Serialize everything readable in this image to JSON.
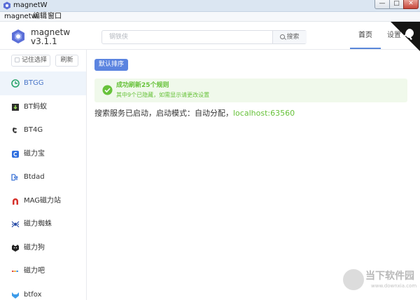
{
  "window": {
    "title": "magnetW",
    "minimize": "—",
    "maximize": "□",
    "close": "✕"
  },
  "menu": [
    "magnetw",
    "编辑",
    "窗口"
  ],
  "header": {
    "app_name": "magnetw",
    "version": "v3.1.1",
    "search_placeholder": "钢铁侠",
    "search_button": "搜索",
    "tabs": [
      {
        "label": "首页",
        "active": true
      },
      {
        "label": "设置",
        "active": false
      }
    ]
  },
  "sidebar": {
    "remember_label": "记住选择",
    "refresh_label": "刷新",
    "items": [
      {
        "label": "BTGG",
        "icon": "btgg-icon",
        "active": true
      },
      {
        "label": "BT蚂蚁",
        "icon": "bt-ant-icon"
      },
      {
        "label": "BT4G",
        "icon": "bt4g-icon"
      },
      {
        "label": "磁力宝",
        "icon": "cilibao-icon"
      },
      {
        "label": "Btdad",
        "icon": "btdad-icon"
      },
      {
        "label": "MAG磁力站",
        "icon": "mag-magnet-icon"
      },
      {
        "label": "磁力蜘蛛",
        "icon": "cili-spider-icon"
      },
      {
        "label": "磁力狗",
        "icon": "cili-dog-icon"
      },
      {
        "label": "磁力吧",
        "icon": "cili-ba-icon"
      },
      {
        "label": "btfox",
        "icon": "btfox-icon"
      }
    ]
  },
  "main": {
    "sort_button": "默认排序",
    "alert": {
      "title": "成功刷新25个规则",
      "description": "其中9个已隐藏，如需显示请更改设置"
    },
    "status_text": "搜索服务已启动，启动模式：自动分配，",
    "status_link": "localhost:63560"
  },
  "watermark": {
    "text": "当下软件园",
    "sub": "www.downxia.com"
  },
  "colors": {
    "accent": "#5b84e0",
    "success": "#67c23a",
    "active_bg": "#eef4fb"
  }
}
